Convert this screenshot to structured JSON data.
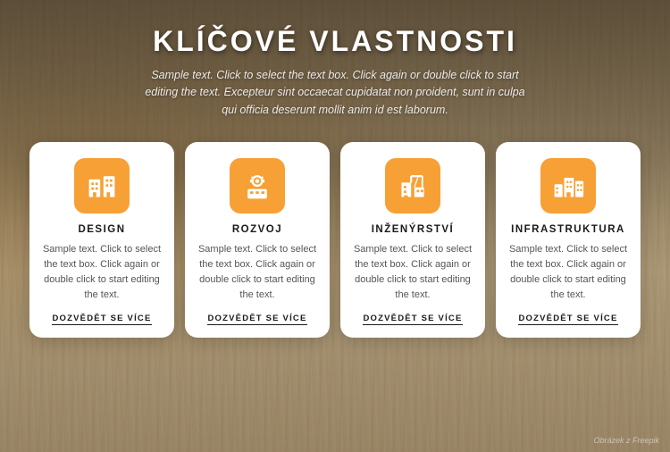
{
  "page": {
    "title": "KLÍČOVÉ VLASTNOSTI",
    "subtitle": "Sample text. Click to select the text box. Click again or double click to start editing the text. Excepteur sint occaecat cupidatat non proident, sunt in culpa qui officia deserunt mollit anim id est laborum.",
    "footer_note": "Obrázek z Freepik"
  },
  "cards": [
    {
      "id": "design",
      "icon": "building",
      "title": "DESIGN",
      "text": "Sample text. Click to select the text box. Click again or double click to start editing the text.",
      "link": "DOZVĚDĚT SE VÍCE"
    },
    {
      "id": "rozvoj",
      "icon": "gear-building",
      "title": "ROZVOJ",
      "text": "Sample text. Click to select the text box. Click again or double click to start editing the text.",
      "link": "DOZVĚDĚT SE VÍCE"
    },
    {
      "id": "inzenyrstvi",
      "icon": "crane-building",
      "title": "INŽENÝRSTVÍ",
      "text": "Sample text. Click to select the text box. Click again or double click to start editing the text.",
      "link": "DOZVĚDĚT SE VÍCE"
    },
    {
      "id": "infrastruktura",
      "icon": "city-building",
      "title": "INFRASTRUKTURA",
      "text": "Sample text. Click to select the text box. Click again or double click to start editing the text.",
      "link": "DOZVĚDĚT SE VÍCE"
    }
  ]
}
